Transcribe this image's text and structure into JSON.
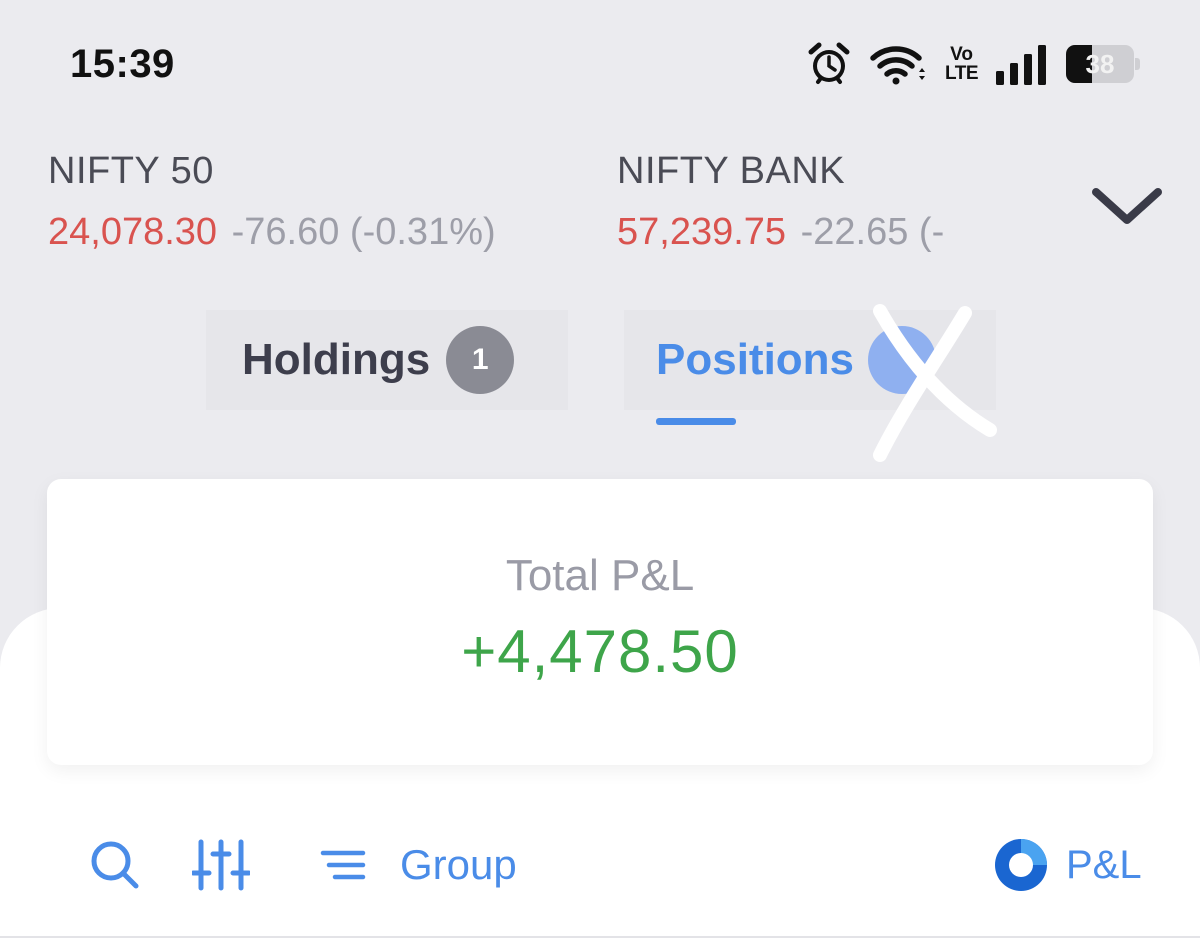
{
  "status_bar": {
    "time": "15:39",
    "volte_top": "Vo",
    "volte_bottom": "LTE",
    "battery_percent": "38",
    "icons": [
      "alarm-icon",
      "wifi-icon",
      "volte-icon",
      "signal-icon",
      "battery-icon"
    ]
  },
  "indices": [
    {
      "name": "NIFTY 50",
      "value": "24,078.30",
      "change": "-76.60 (-0.31%)"
    },
    {
      "name": "NIFTY BANK",
      "value": "57,239.75",
      "change": "-22.65 (-"
    }
  ],
  "tabs": {
    "holdings": {
      "label": "Holdings",
      "count": "1"
    },
    "positions": {
      "label": "Positions",
      "active": true
    }
  },
  "pnl": {
    "label": "Total P&L",
    "value": "+4,478.50"
  },
  "toolbar": {
    "group_label": "Group",
    "pnl_toggle_label": "P&L",
    "icons": [
      "search-icon",
      "filter-sliders-icon",
      "group-lines-icon",
      "pnl-toggle-icon"
    ]
  },
  "colors": {
    "background": "#ebebef",
    "accent_blue": "#4a8ce8",
    "negative_red": "#d9534f",
    "positive_green": "#3ea54a",
    "muted_grey": "#9d9ea8"
  }
}
